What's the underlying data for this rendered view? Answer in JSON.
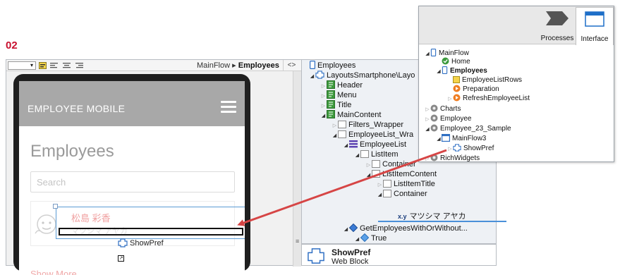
{
  "step_label": "02",
  "editor": {
    "dropdown_value": "",
    "breadcrumb": {
      "flow": "MainFlow",
      "separator": "▸",
      "screen": "Employees"
    },
    "code_toggle": "<>",
    "phone": {
      "app_title": "EMPLOYEE MOBILE",
      "page_title": "Employees",
      "search_placeholder": "Search",
      "employee_name": "松島 彩香",
      "employee_kana": "マツシマ アヤカ",
      "dragged_block_label": "ShowPref",
      "show_more": "Show More..."
    },
    "scroll_glyph": "≡"
  },
  "tree": {
    "items": [
      {
        "label": "Employees",
        "expander": "",
        "icon": "screen-icon"
      },
      {
        "label": "LayoutsSmartphone\\Layo",
        "expander": "◢",
        "icon": "block-icon"
      },
      {
        "label": "Header",
        "expander": "▷",
        "icon": "placeholder-icon"
      },
      {
        "label": "Menu",
        "expander": "▷",
        "icon": "placeholder-icon"
      },
      {
        "label": "Title",
        "expander": "▷",
        "icon": "placeholder-icon"
      },
      {
        "label": "MainContent",
        "expander": "◢",
        "icon": "placeholder-icon"
      },
      {
        "label": "Filters_Wrapper",
        "expander": "▷",
        "icon": "container-icon"
      },
      {
        "label": "EmployeeList_Wra",
        "expander": "◢",
        "icon": "container-icon"
      },
      {
        "label": "EmployeeList",
        "expander": "◢",
        "icon": "list-icon"
      },
      {
        "label": "ListItem",
        "expander": "◢",
        "icon": "container-icon"
      },
      {
        "label": "Container",
        "expander": "▷",
        "icon": "container-icon"
      },
      {
        "label": "ListItemContent",
        "expander": "◢",
        "icon": "container-icon"
      },
      {
        "label": "ListItemTitle",
        "expander": "▷",
        "icon": "container-icon"
      },
      {
        "label": "Container",
        "expander": "◢",
        "icon": "container-icon"
      },
      {
        "label": "GetEmployeesWithOrWithout...",
        "expander": "◢",
        "icon": "if-icon"
      },
      {
        "label": "True",
        "expander": "◢",
        "icon": "branch-icon"
      }
    ],
    "expression_tag": "x.y",
    "expression_value": "マツシマ アヤカ"
  },
  "properties": {
    "name": "ShowPref",
    "type": "Web Block"
  },
  "panel": {
    "tabs": [
      {
        "label": "Processes",
        "icon": "processes-icon"
      },
      {
        "label": "Interface",
        "icon": "interface-icon",
        "active": true
      }
    ],
    "items": [
      {
        "label": "MainFlow",
        "expander": "◢",
        "icon": "flow-icon",
        "bold": false
      },
      {
        "label": "Home",
        "expander": "",
        "icon": "home-check-icon",
        "bold": false
      },
      {
        "label": "Employees",
        "expander": "◢",
        "icon": "screen-icon",
        "bold": true
      },
      {
        "label": "EmployeeListRows",
        "expander": "",
        "icon": "yellow-square-icon",
        "bold": false
      },
      {
        "label": "Preparation",
        "expander": "",
        "icon": "orange-action-icon",
        "bold": false
      },
      {
        "label": "RefreshEmployeeList",
        "expander": "▷",
        "icon": "orange-action-icon",
        "bold": false
      },
      {
        "label": "Charts",
        "expander": "▷",
        "icon": "module-icon",
        "bold": false
      },
      {
        "label": "Employee",
        "expander": "▷",
        "icon": "module-icon",
        "bold": false
      },
      {
        "label": "Employee_23_Sample",
        "expander": "◢",
        "icon": "module-icon",
        "bold": false
      },
      {
        "label": "MainFlow3",
        "expander": "◢",
        "icon": "flow-icon",
        "bold": false
      },
      {
        "label": "ShowPref",
        "expander": "▷",
        "icon": "block-icon",
        "bold": false
      },
      {
        "label": "RichWidgets",
        "expander": "▷",
        "icon": "module-icon",
        "bold": false
      }
    ]
  },
  "colors": {
    "step": "#c8102e",
    "drag_arrow": "#d64545",
    "selection": "#5b9bd5",
    "app_bar": "#a8a8a8"
  }
}
